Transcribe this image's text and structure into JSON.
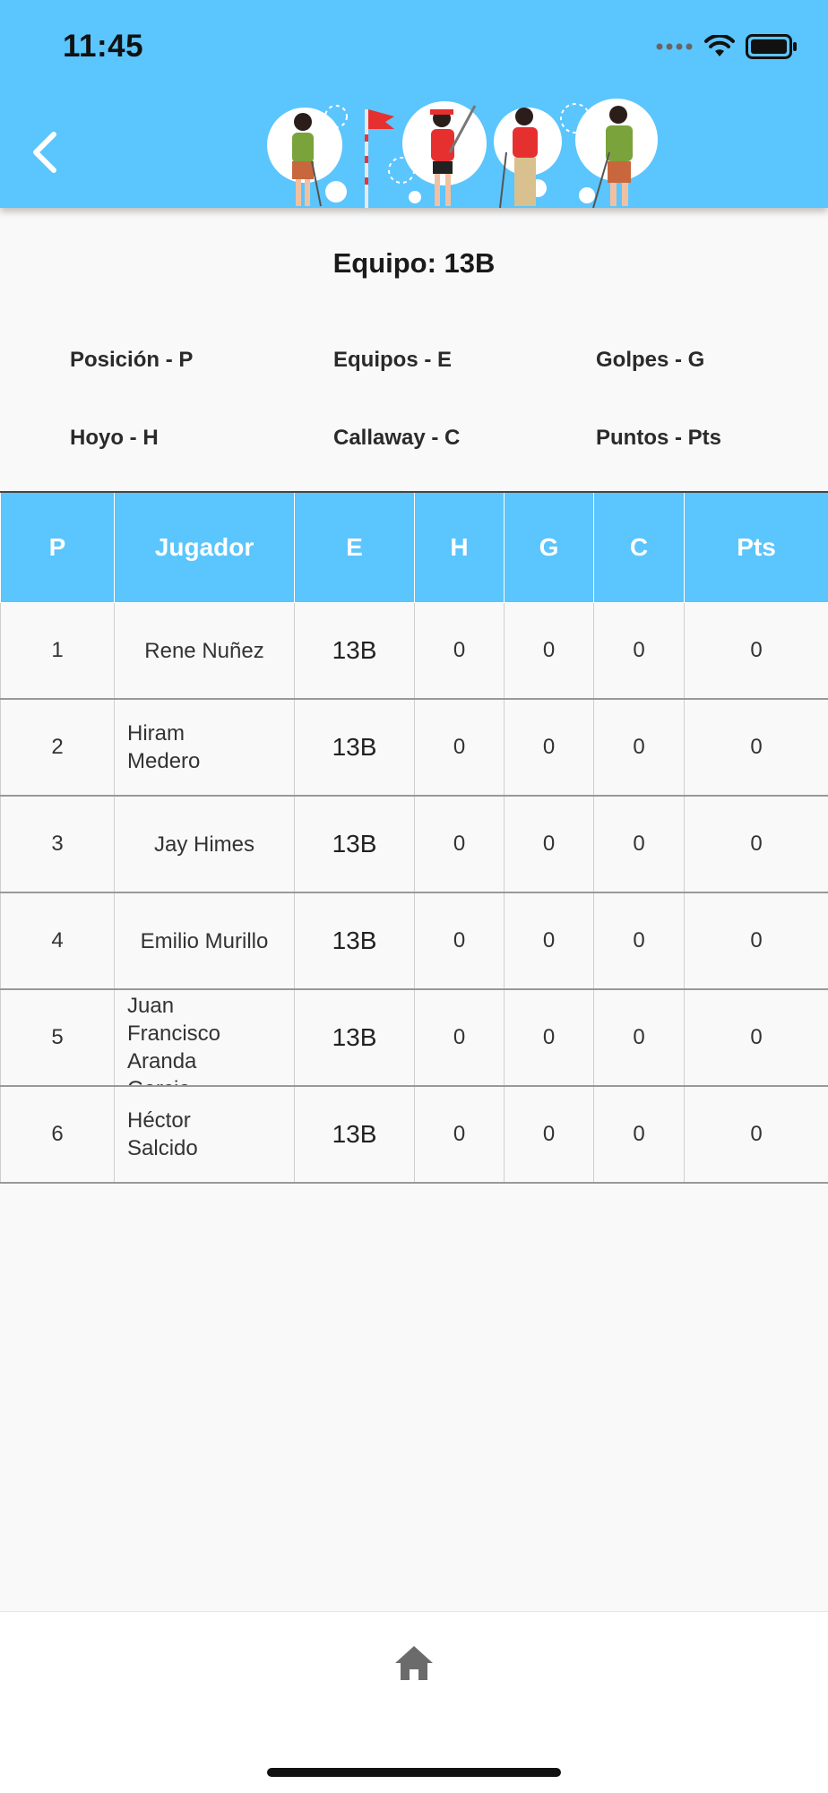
{
  "status_bar": {
    "time": "11:45"
  },
  "header": {
    "back_icon": "chevron-left-icon",
    "banner": "golf-players-illustration"
  },
  "team_title": "Equipo: 13B",
  "legend": [
    "Posición - P",
    "Equipos - E",
    "Golpes - G",
    "Hoyo - H",
    "Callaway - C",
    "Puntos - Pts"
  ],
  "table": {
    "columns": [
      "P",
      "Jugador",
      "E",
      "H",
      "G",
      "C",
      "Pts"
    ],
    "rows": [
      [
        "1",
        "Rene Nuñez",
        "13B",
        "0",
        "0",
        "0",
        "0"
      ],
      [
        "2",
        "Hiram Medero",
        "13B",
        "0",
        "0",
        "0",
        "0"
      ],
      [
        "3",
        "Jay Himes",
        "13B",
        "0",
        "0",
        "0",
        "0"
      ],
      [
        "4",
        "Emilio Murillo",
        "13B",
        "0",
        "0",
        "0",
        "0"
      ],
      [
        "5",
        "Juan Francisco Aranda Garcia",
        "13B",
        "0",
        "0",
        "0",
        "0"
      ],
      [
        "6",
        "Héctor Salcido",
        "13B",
        "0",
        "0",
        "0",
        "0"
      ]
    ]
  },
  "bottom_nav": {
    "home_icon": "home-icon"
  },
  "colors": {
    "header": "#5bc5fd",
    "background": "#f9f9f9"
  }
}
